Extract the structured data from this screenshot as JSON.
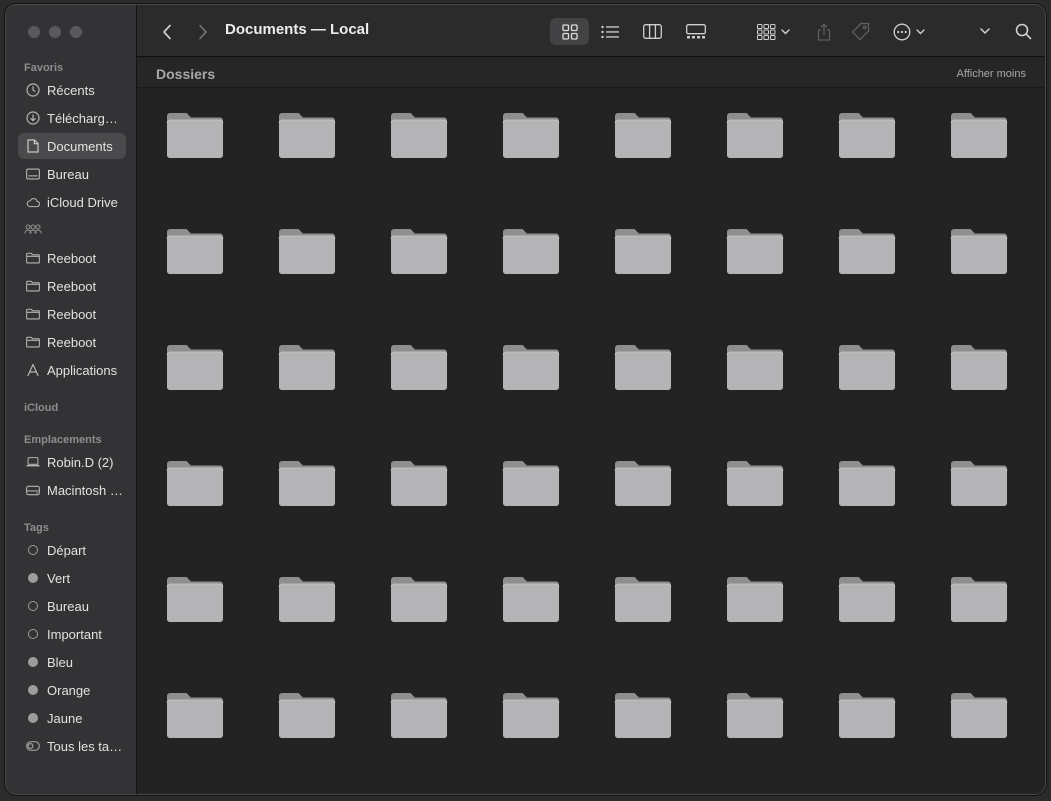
{
  "window": {
    "title": "Documents — Local"
  },
  "sidebar": {
    "favorites_label": "Favoris",
    "favorites": [
      {
        "label": "Récents",
        "icon": "clock-icon"
      },
      {
        "label": "Téléchargements",
        "icon": "download-icon"
      },
      {
        "label": "Documents",
        "icon": "document-icon",
        "selected": true
      },
      {
        "label": "Bureau",
        "icon": "desktop-icon"
      },
      {
        "label": "iCloud Drive",
        "icon": "cloud-icon"
      }
    ],
    "shared_icon": "people-icon",
    "shared": [
      {
        "label": "Reeboot",
        "icon": "folder-icon"
      },
      {
        "label": "Reeboot",
        "icon": "folder-icon"
      },
      {
        "label": "Reeboot",
        "icon": "folder-icon"
      },
      {
        "label": "Reeboot",
        "icon": "folder-icon"
      },
      {
        "label": "Applications",
        "icon": "applications-icon"
      }
    ],
    "icloud_label": "iCloud",
    "locations_label": "Emplacements",
    "locations": [
      {
        "label": "Robin.D (2)",
        "icon": "laptop-icon"
      },
      {
        "label": "Macintosh HD",
        "icon": "disk-icon"
      }
    ],
    "tags_label": "Tags",
    "tags": [
      {
        "label": "Départ",
        "style": "hollow"
      },
      {
        "label": "Vert",
        "style": "filled"
      },
      {
        "label": "Bureau",
        "style": "hollow"
      },
      {
        "label": "Important",
        "style": "hollow"
      },
      {
        "label": "Bleu",
        "style": "filled"
      },
      {
        "label": "Orange",
        "style": "filled"
      },
      {
        "label": "Jaune",
        "style": "filled"
      },
      {
        "label": "Tous les tags…",
        "style": "all"
      }
    ]
  },
  "toolbar": {
    "view_modes": [
      "icon-view-icon",
      "list-view-icon",
      "column-view-icon",
      "gallery-view-icon"
    ],
    "active_view": "icon-view-icon"
  },
  "main": {
    "group_title": "Dossiers",
    "group_toggle": "Afficher moins",
    "folder_rows": 6,
    "folder_cols": 8
  },
  "colors": {
    "sidebar_bg": "#333335",
    "content_bg": "#232323",
    "folder": "#b4b4b6"
  }
}
